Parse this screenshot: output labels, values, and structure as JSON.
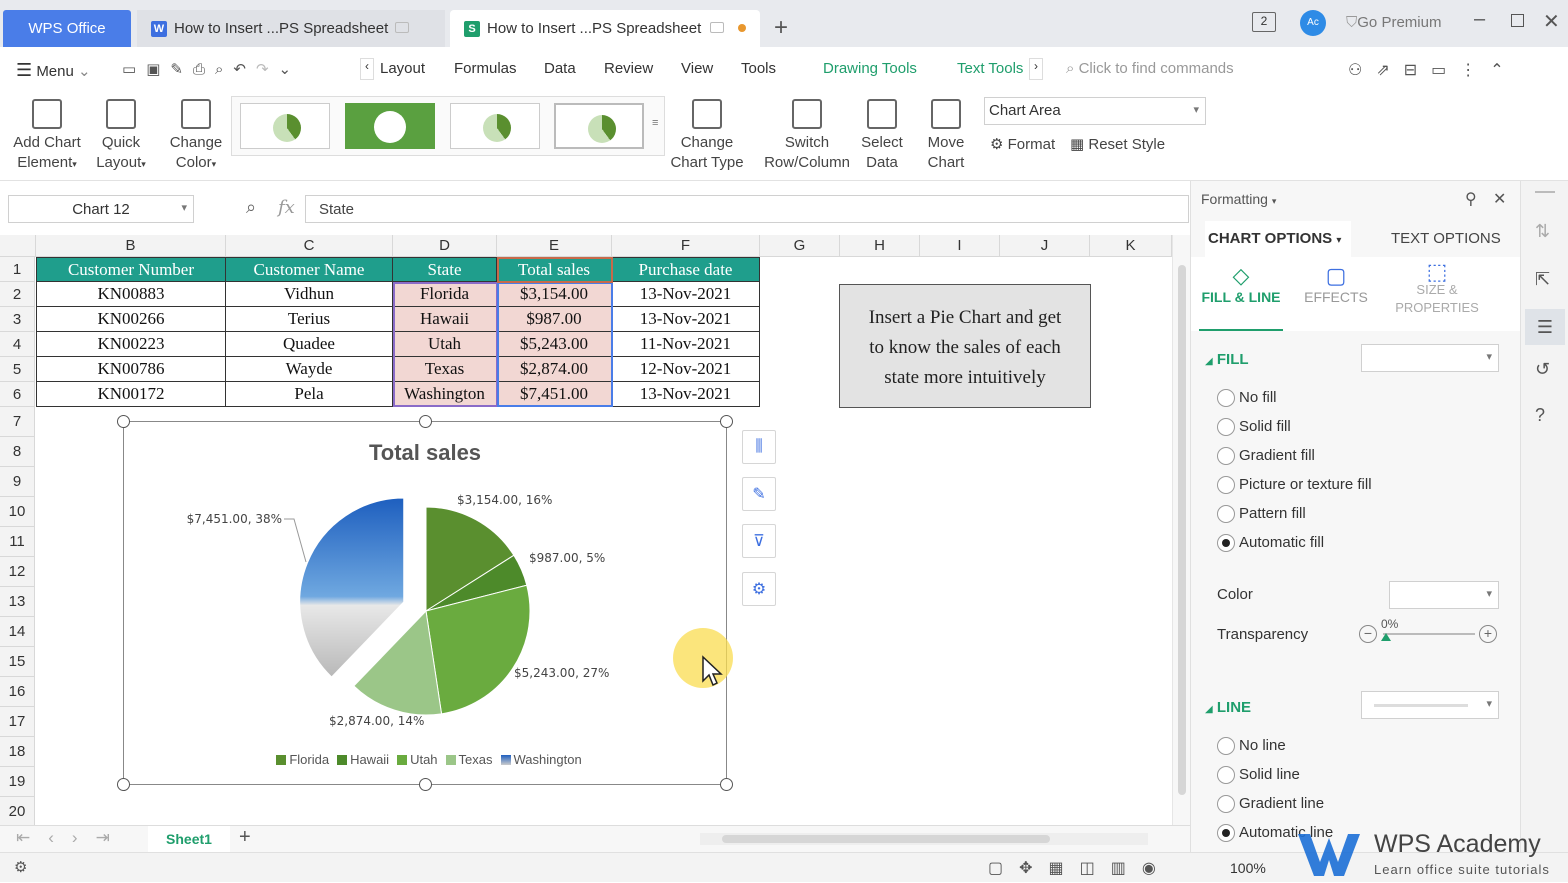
{
  "tabs": {
    "app": "WPS Office",
    "doc1": "How to Insert ...PS Spreadsheet",
    "doc2": "How to Insert ...PS Spreadsheet",
    "new_tab": "+",
    "go_premium": "Go Premium",
    "badge": "2",
    "avatar": "Ac"
  },
  "menu": {
    "menu_label": "Menu",
    "items": [
      "Layout",
      "Formulas",
      "Data",
      "Review",
      "View",
      "Tools"
    ],
    "drawing_tools": "Drawing Tools",
    "text_tools": "Text Tools",
    "search_placeholder": "Click to find commands"
  },
  "ribbon": {
    "add_chart_element": [
      "Add Chart",
      "Element"
    ],
    "quick_layout": [
      "Quick",
      "Layout"
    ],
    "change_color": [
      "Change",
      "Color"
    ],
    "change_chart_type": [
      "Change",
      "Chart Type"
    ],
    "switch_row_column": [
      "Switch",
      "Row/Column"
    ],
    "select_data": [
      "Select",
      "Data"
    ],
    "move_chart": [
      "Move",
      "Chart"
    ],
    "chart_area_select": "Chart Area",
    "format": "Format",
    "reset_style": "Reset Style"
  },
  "formula_bar": {
    "name_box": "Chart 12",
    "fx": "fx",
    "value": "State"
  },
  "columns": [
    "B",
    "C",
    "D",
    "E",
    "F",
    "G",
    "H",
    "I",
    "J",
    "K"
  ],
  "rows": [
    "1",
    "2",
    "3",
    "4",
    "5",
    "6",
    "7",
    "8",
    "9",
    "10",
    "11",
    "12",
    "13",
    "14",
    "15",
    "16",
    "17",
    "18",
    "19",
    "20"
  ],
  "table": {
    "headers": [
      "Customer Number",
      "Customer Name",
      "State",
      "Total sales",
      "Purchase date"
    ],
    "rows": [
      [
        "KN00883",
        "Vidhun",
        "Florida",
        "$3,154.00",
        "13-Nov-2021"
      ],
      [
        "KN00266",
        "Terius",
        "Hawaii",
        "$987.00",
        "13-Nov-2021"
      ],
      [
        "KN00223",
        "Quadee",
        "Utah",
        "$5,243.00",
        "11-Nov-2021"
      ],
      [
        "KN00786",
        "Wayde",
        "Texas",
        "$2,874.00",
        "12-Nov-2021"
      ],
      [
        "KN00172",
        "Pela",
        "Washington",
        "$7,451.00",
        "13-Nov-2021"
      ]
    ]
  },
  "note": [
    "Insert a Pie Chart and get",
    "to know the sales of each",
    "state more intuitively"
  ],
  "chart_data": {
    "type": "pie",
    "title": "Total sales",
    "categories": [
      "Florida",
      "Hawaii",
      "Utah",
      "Texas",
      "Washington"
    ],
    "values": [
      3154,
      987,
      5243,
      2874,
      7451
    ],
    "data_labels": [
      "$3,154.00, 16%",
      "$987.00, 5%",
      "$5,243.00, 27%",
      "$2,874.00, 14%",
      "$7,451.00, 38%"
    ],
    "colors": [
      "#5a8f2f",
      "#4d8a2a",
      "#6aab3f",
      "#9bc688",
      "#3b7fd1"
    ],
    "legend_position": "bottom",
    "exploded_slice": "Washington"
  },
  "panel": {
    "header": "Formatting",
    "tab_chart_options": "CHART OPTIONS",
    "tab_text_options": "TEXT OPTIONS",
    "sub_fill_line": "FILL & LINE",
    "sub_effects": "EFFECTS",
    "sub_size": [
      "SIZE &",
      "PROPERTIES"
    ],
    "fill_section": "FILL",
    "fill_options": [
      "No fill",
      "Solid fill",
      "Gradient fill",
      "Picture or texture fill",
      "Pattern fill",
      "Automatic fill"
    ],
    "fill_selected": "Automatic fill",
    "color_label": "Color",
    "transparency_label": "Transparency",
    "transparency_value": "0%",
    "line_section": "LINE",
    "line_options": [
      "No line",
      "Solid line",
      "Gradient line",
      "Automatic line"
    ],
    "line_selected": "Automatic line"
  },
  "sheets": {
    "active": "Sheet1",
    "add": "+"
  },
  "status": {
    "zoom": "100%"
  },
  "watermark": {
    "brand": "WPS Academy",
    "tagline": "Learn office suite tutorials"
  },
  "accent_color": "#1f9e8c"
}
